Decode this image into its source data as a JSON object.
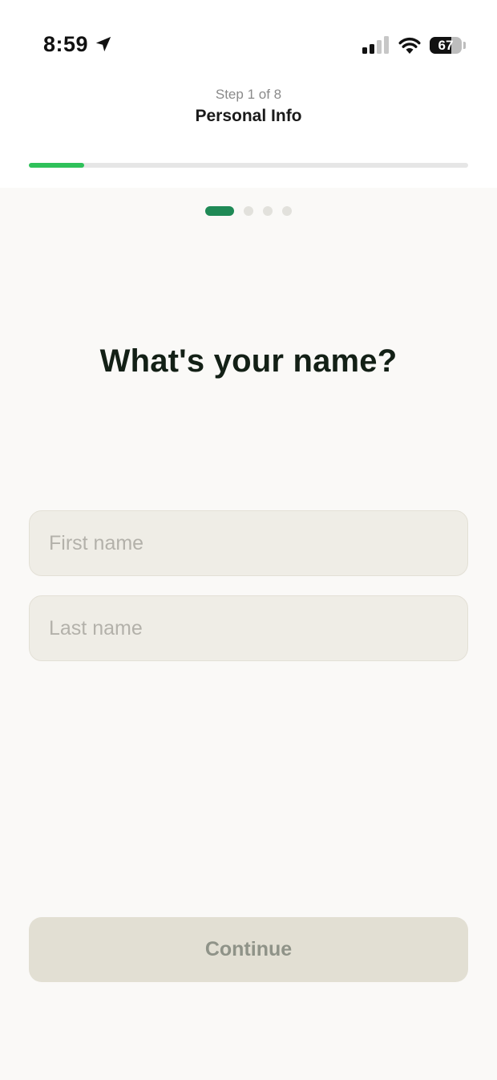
{
  "status_bar": {
    "time": "8:59",
    "battery_percent": "67",
    "battery_level": 0.67,
    "location_icon": "location-arrow-icon",
    "signal_icon": "cellular-signal-icon",
    "wifi_icon": "wifi-icon"
  },
  "header": {
    "step_label": "Step 1 of 8",
    "title": "Personal Info"
  },
  "progress": {
    "current_step": 1,
    "total_steps": 8,
    "fraction": 0.125,
    "color": "#2fc15a"
  },
  "page_indicator": {
    "count": 4,
    "active_index": 0,
    "active_color": "#1f8a56"
  },
  "question": "What's your name?",
  "form": {
    "first_name_placeholder": "First name",
    "first_name_value": "",
    "last_name_placeholder": "Last name",
    "last_name_value": ""
  },
  "continue_label": "Continue"
}
